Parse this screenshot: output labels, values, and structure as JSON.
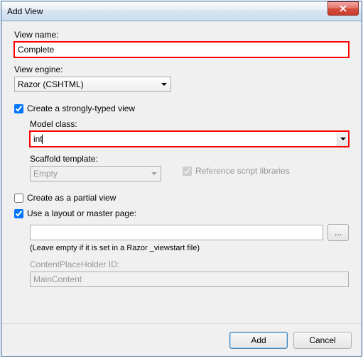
{
  "window": {
    "title": "Add View"
  },
  "viewName": {
    "label": "View name:",
    "value": "Complete"
  },
  "viewEngine": {
    "label": "View engine:",
    "value": "Razor (CSHTML)"
  },
  "stronglyTyped": {
    "label": "Create a strongly-typed view",
    "checked": true
  },
  "modelClass": {
    "label": "Model class:",
    "value": "int"
  },
  "scaffold": {
    "label": "Scaffold template:",
    "value": "Empty"
  },
  "refScript": {
    "label": "Reference script libraries",
    "checked": true
  },
  "partial": {
    "label": "Create as a partial view",
    "checked": false
  },
  "useLayout": {
    "label": "Use a layout or master page:",
    "checked": true
  },
  "layoutPath": {
    "value": ""
  },
  "layoutHint": "(Leave empty if it is set in a Razor _viewstart file)",
  "placeholder": {
    "label": "ContentPlaceHolder ID:",
    "value": "MainContent"
  },
  "browse": {
    "label": "..."
  },
  "buttons": {
    "ok": "Add",
    "cancel": "Cancel"
  },
  "icons": {
    "close": "close"
  }
}
